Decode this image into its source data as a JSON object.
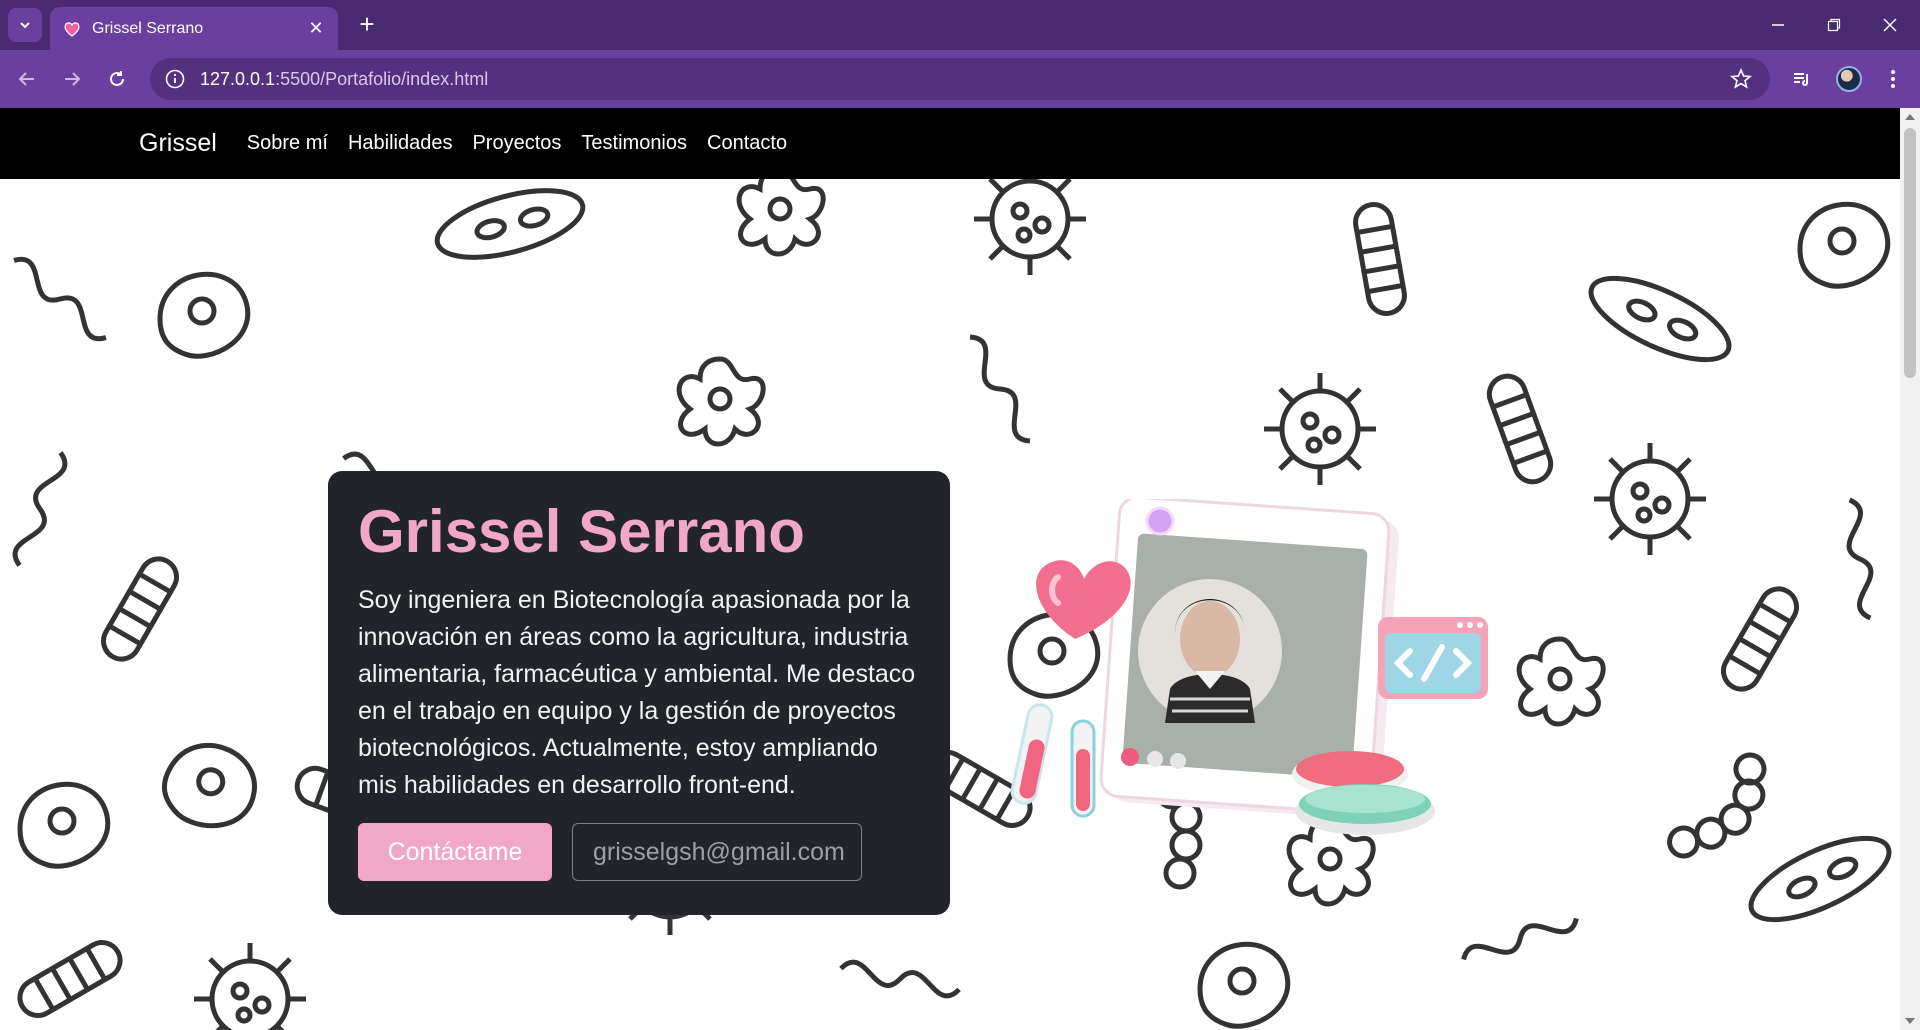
{
  "browser": {
    "tab_title": "Grissel Serrano",
    "url_host": "127.0.0.1",
    "url_path": ":5500/Portafolio/index.html"
  },
  "site": {
    "brand": "Grissel",
    "nav": [
      "Sobre mí",
      "Habilidades",
      "Proyectos",
      "Testimonios",
      "Contacto"
    ]
  },
  "hero": {
    "name": "Grissel Serrano",
    "bio": "Soy ingeniera en Biotecnología apasionada por la innovación en áreas como la agricultura, industria alimentaria, farmacéutica y ambiental. Me destaco en el trabajo en equipo y la gestión de proyectos biotecnológicos. Actualmente, estoy ampliando mis habilidades en desarrollo front-end.",
    "cta_label": "Contáctame",
    "email_placeholder": "grisselgsh@gmail.com"
  },
  "colors": {
    "accent": "#f1a7c8",
    "card_bg": "#212529",
    "chrome": "#6b3fa0"
  }
}
